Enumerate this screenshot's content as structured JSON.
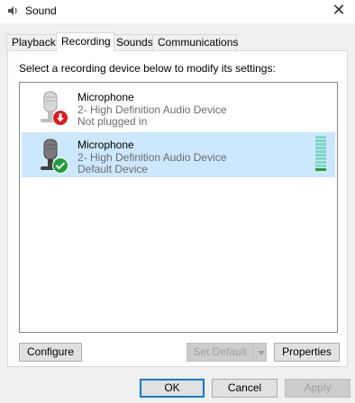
{
  "window": {
    "title": "Sound",
    "close_glyph": "✕",
    "icon": "speaker-icon"
  },
  "tabs": [
    {
      "label": "Playback",
      "active": false
    },
    {
      "label": "Recording",
      "active": true
    },
    {
      "label": "Sounds",
      "active": false
    },
    {
      "label": "Communications",
      "active": false
    }
  ],
  "recording": {
    "instruction": "Select a recording device below to modify its settings:",
    "devices": [
      {
        "name": "Microphone",
        "description": "2- High Definition Audio Device",
        "status": "Not plugged in",
        "selected": false,
        "badge": "red-down-arrow-icon",
        "badge_color": "#d81e1e"
      },
      {
        "name": "Microphone",
        "description": "2- High Definition Audio Device",
        "status": "Default Device",
        "selected": true,
        "badge": "green-check-icon",
        "badge_color": "#1e9e3a",
        "level_meter_active_fraction": 0.1
      }
    ],
    "buttons": {
      "configure": "Configure",
      "set_default": "Set Default",
      "properties": "Properties"
    }
  },
  "dialog_buttons": {
    "ok": "OK",
    "cancel": "Cancel",
    "apply": "Apply"
  },
  "colors": {
    "selection": "#cce8ff",
    "accent": "#0078d7",
    "meter_idle": "#7fd6c8",
    "meter_active": "#22a03a"
  }
}
